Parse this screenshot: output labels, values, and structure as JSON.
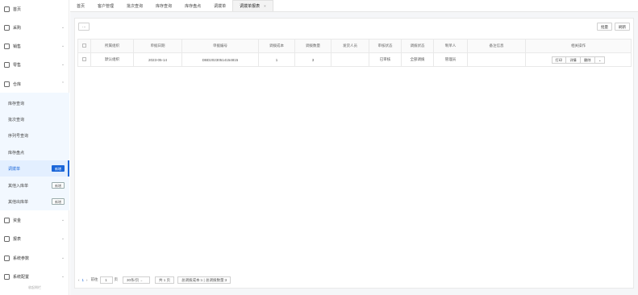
{
  "sidebar": {
    "items": [
      {
        "label": "首页",
        "icon": "monitor-icon",
        "chevron": ""
      },
      {
        "label": "采购",
        "icon": "download-icon",
        "chevron": "⌄"
      },
      {
        "label": "销售",
        "icon": "upload-icon",
        "chevron": "⌄"
      },
      {
        "label": "零售",
        "icon": "bag-icon",
        "chevron": "⌄"
      },
      {
        "label": "仓库",
        "icon": "home-icon",
        "chevron": "⌃"
      },
      {
        "label": "资金",
        "icon": "wallet-icon",
        "chevron": "⌄"
      },
      {
        "label": "报表",
        "icon": "chart-icon",
        "chevron": "⌄"
      },
      {
        "label": "系统参数",
        "icon": "grid-icon",
        "chevron": "⌄"
      },
      {
        "label": "系统配置",
        "icon": "settings-icon",
        "chevron": "⌄"
      }
    ],
    "submenu": [
      {
        "label": "库存查询",
        "badge": ""
      },
      {
        "label": "批次查询",
        "badge": ""
      },
      {
        "label": "序列号查询",
        "badge": ""
      },
      {
        "label": "库存盘点",
        "badge": ""
      },
      {
        "label": "调拨单",
        "badge": "新增"
      },
      {
        "label": "其他入库单",
        "badge": "新增"
      },
      {
        "label": "其他出库单",
        "badge": "新增"
      }
    ],
    "footer": "收起侧栏"
  },
  "tabs": [
    {
      "label": "首页"
    },
    {
      "label": "客户管理"
    },
    {
      "label": "批次查询"
    },
    {
      "label": "库存查询"
    },
    {
      "label": "库存盘点"
    },
    {
      "label": "调拨单"
    },
    {
      "label": "调拨单报表",
      "close": "×"
    }
  ],
  "toolbar": {
    "more": "···",
    "batch": "批量",
    "refresh": "刷新"
  },
  "table": {
    "headers": [
      "",
      "所属组织",
      "单据日期",
      "单据编号",
      "调拨成本",
      "调拨数量",
      "发货人员",
      "审核状态",
      "调拨状态",
      "制单人",
      "备注信息",
      "相关操作"
    ],
    "rows": [
      {
        "org": "默认组织",
        "date": "2023-05-14",
        "number": "DBD20230514154815",
        "cost": "1",
        "qty": "3",
        "shipper": "",
        "audit": "已审核",
        "status": "全部调拨",
        "maker": "管理员",
        "remark": "",
        "actions": {
          "print": "打印",
          "detail": "详情",
          "delete": "删除",
          "more": "⌄"
        }
      }
    ]
  },
  "pager": {
    "prev": "‹",
    "page": "1",
    "next": "›",
    "goto": "前往",
    "page_input": "1",
    "page_unit": "页",
    "page_size": "30条/页",
    "page_size_arrow": "⌄",
    "total_pages": "共 1 页",
    "summary": "总调拨成本:1 | 总调拨数量:3"
  }
}
